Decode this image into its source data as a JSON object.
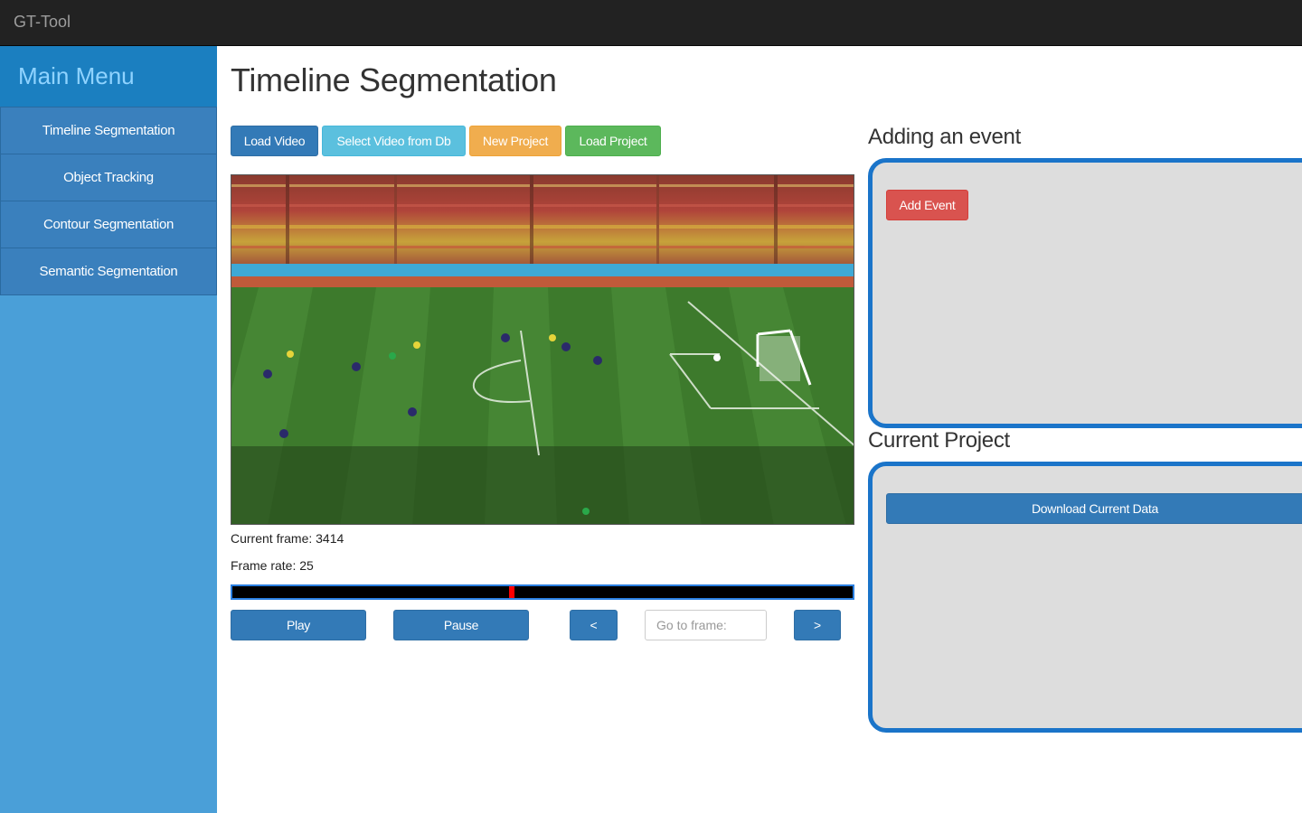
{
  "app": {
    "title": "GT-Tool"
  },
  "sidebar": {
    "header": "Main Menu",
    "items": [
      {
        "label": "Timeline Segmentation"
      },
      {
        "label": "Object Tracking"
      },
      {
        "label": "Contour Segmentation"
      },
      {
        "label": "Semantic Segmentation"
      }
    ]
  },
  "page": {
    "title": "Timeline Segmentation"
  },
  "toolbar": {
    "load_video": "Load Video",
    "select_video": "Select Video from Db",
    "new_project": "New Project",
    "load_project": "Load Project"
  },
  "video": {
    "current_frame_text": "Current frame: 3414",
    "frame_rate_text": "Frame rate: 25",
    "timeline_position_fraction": 0.45
  },
  "controls": {
    "play": "Play",
    "pause": "Pause",
    "prev": "<",
    "next": ">",
    "goto_placeholder": "Go to frame:"
  },
  "events": {
    "title": "Adding an event",
    "add_event": "Add Event"
  },
  "project": {
    "title": "Current Project",
    "download": "Download Current Data"
  },
  "colors": {
    "navbar": "#222222",
    "sidebar": "#4a9fd8",
    "sidebar_header": "#1b7fc0",
    "panel_border": "#1a74c9",
    "timeline_marker": "#ff0000"
  }
}
